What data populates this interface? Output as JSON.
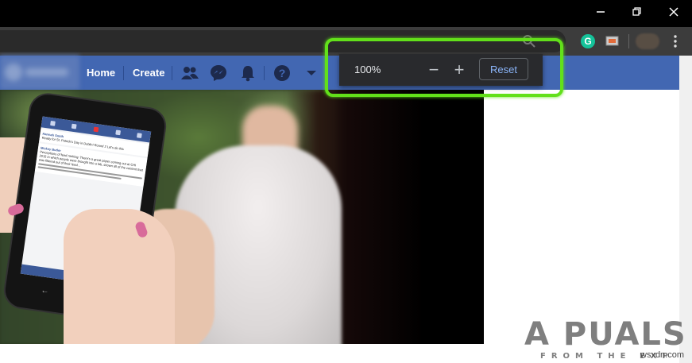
{
  "facebook_nav": {
    "home_label": "Home",
    "create_label": "Create",
    "icons": [
      "friends-icon",
      "messenger-icon",
      "notifications-icon",
      "help-icon",
      "dropdown-icon"
    ],
    "bar_color": "#4267b2"
  },
  "zoom_popup": {
    "zoom_level": "100%",
    "zoom_out_label": "−",
    "zoom_in_label": "+",
    "reset_label": "Reset",
    "highlight_color": "#62e01a"
  },
  "browser": {
    "extension_letter": "G",
    "icons": [
      "minimize-icon",
      "restore-icon",
      "close-icon",
      "zoom-icon",
      "grammarly-icon",
      "cast-icon",
      "menu-icon"
    ]
  },
  "phone_screen": {
    "post1_author": "Hannah Smith",
    "post1_text": "Ready for St. Patrick's Day in Dublin! Round 2 Let's do this",
    "post2_author": "Mickey Butler",
    "post2_text": "Perceptions of feed ranking: There's a great paper coming out at CHI 2015 in which people were brought into a lab, shown all of the content that was filtered out of their feed..."
  },
  "watermark": {
    "logo": "A  PUALS",
    "tagline": "FROM THE EXP",
    "site": "wsxdn.com"
  }
}
